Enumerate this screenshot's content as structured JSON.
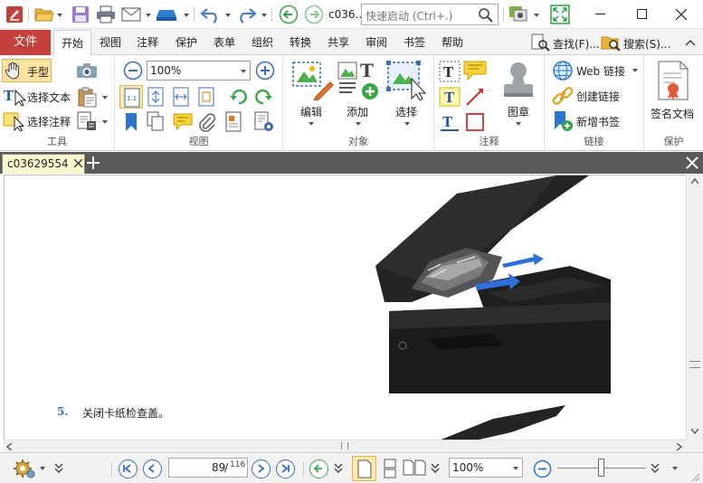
{
  "title_bar": {
    "doc_title": "c036..",
    "quick_launch_placeholder": "快速启动 (Ctrl+.)"
  },
  "tabs": {
    "file": "文件",
    "items": [
      "开始",
      "视图",
      "注释",
      "保护",
      "表单",
      "组织",
      "转换",
      "共享",
      "审阅",
      "书签",
      "帮助"
    ],
    "active": "开始",
    "find": "查找(F)...",
    "search": "搜索(S)..."
  },
  "ribbon": {
    "tools": {
      "label": "工具",
      "hand": "手型",
      "select_text": "选择文本",
      "select_annotation": "选择注释"
    },
    "view": {
      "label": "视图",
      "zoom": "100%"
    },
    "objects": {
      "label": "对象",
      "edit": "编辑",
      "add": "添加",
      "select": "选择"
    },
    "comments": {
      "label": "注释",
      "stamp": "图章"
    },
    "links": {
      "label": "链接",
      "web_link": "Web 链接",
      "create_link": "创建链接",
      "new_bookmark": "新增书签"
    },
    "protect": {
      "label": "保护",
      "sign": "签名文档"
    }
  },
  "document": {
    "tab_name": "c03629554",
    "step_number": "5.",
    "step_text": "关闭卡纸检查盖。"
  },
  "status": {
    "current_page": "89",
    "total_pages": "116",
    "zoom": "100%"
  },
  "colors": {
    "file_tab": "#c5403b",
    "accent_blue": "#3a6fb5",
    "doc_strip": "#5a5a5a",
    "doc_tab": "#fff8cf"
  }
}
